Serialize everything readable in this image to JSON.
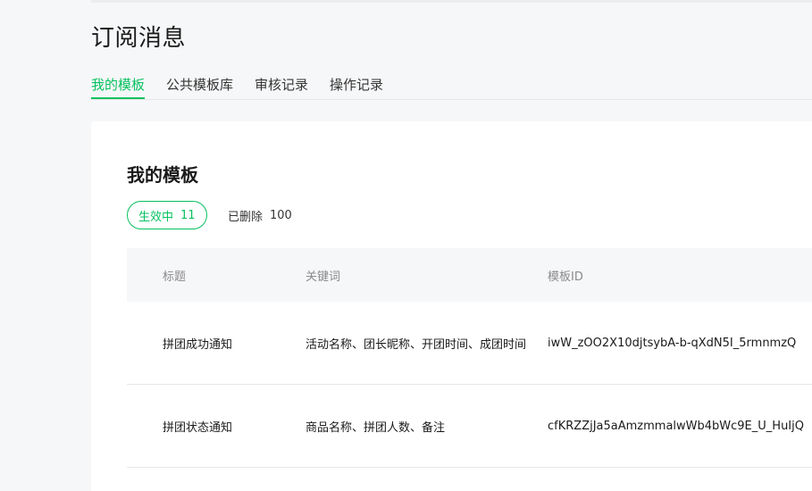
{
  "page": {
    "title": "订阅消息"
  },
  "tabs": [
    {
      "label": "我的模板",
      "active": true
    },
    {
      "label": "公共模板库",
      "active": false
    },
    {
      "label": "审核记录",
      "active": false
    },
    {
      "label": "操作记录",
      "active": false
    }
  ],
  "section": {
    "title": "我的模板",
    "filters": {
      "active": {
        "label": "生效中",
        "count": "11"
      },
      "deleted": {
        "label": "已删除",
        "count": "100"
      }
    }
  },
  "table": {
    "columns": [
      "标题",
      "关键词",
      "模板ID"
    ],
    "rows": [
      {
        "title": "拼团成功通知",
        "keywords": "活动名称、团长昵称、开团时间、成团时间",
        "template_id": "iwW_zOO2X10djtsybA-b-qXdN5I_5rmnmzQ"
      },
      {
        "title": "拼团状态通知",
        "keywords": "商品名称、拼团人数、备注",
        "template_id": "cfKRZZjJa5aAmzmmalwWb4bWc9E_U_HuIjQ"
      }
    ]
  },
  "colors": {
    "accent": "#07c160",
    "background": "#f6f7f8",
    "card": "#ffffff"
  }
}
